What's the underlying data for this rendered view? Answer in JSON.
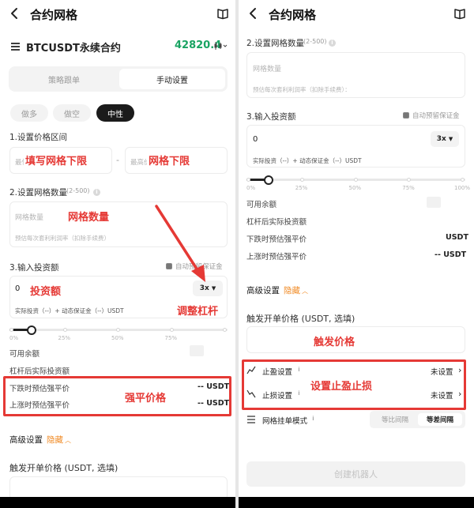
{
  "left": {
    "header": {
      "title": "合约网格"
    },
    "pair": {
      "name": "BTCUSDT永续合约",
      "price": "42820.4"
    },
    "tabs": [
      {
        "label": "策略跟单"
      },
      {
        "label": "手动设置"
      }
    ],
    "modes": [
      {
        "label": "做多"
      },
      {
        "label": "做空"
      },
      {
        "label": "中性"
      }
    ],
    "price_range": {
      "label": "1.设置价格区间",
      "lower_placeholder": "最低价",
      "upper_placeholder": "最高价",
      "dash": "-"
    },
    "grid_count": {
      "label": "2.设置网格数量",
      "range": "(2-500)",
      "placeholder": "网格数量",
      "hint": "预估每次套利利润率（扣除手续费）"
    },
    "invest": {
      "label": "3.输入投资额",
      "auto_margin": "自动预留保证金",
      "value": "0",
      "leverage": "3x",
      "detail": "实际投资（--）+ 动态保证金（--）USDT"
    },
    "slider": {
      "level": 0.1,
      "ticks": [
        "0%",
        "25%",
        "50%",
        "75%"
      ]
    },
    "rows": [
      {
        "label": "可用余额",
        "value": ""
      },
      {
        "label": "杠杆后实际投资额",
        "value": ""
      },
      {
        "label": "下跌时预估强平价",
        "value": "-- USDT"
      },
      {
        "label": "上涨时预估强平价",
        "value": "-- USDT"
      }
    ],
    "advanced": {
      "label": "高级设置",
      "toggle": "隐藏"
    },
    "trigger": {
      "label": "触发开单价格 (USDT, 选填)"
    },
    "annotations": {
      "lower": "填写网格下限",
      "upper": "网格下限",
      "count": "网格数量",
      "invest": "投资额",
      "leverage": "调整杠杆",
      "liq": "强平价格"
    }
  },
  "right": {
    "header": {
      "title": "合约网格"
    },
    "grid_count": {
      "label": "2.设置网格数量",
      "range": "(2-500)",
      "placeholder": "网格数量",
      "hint": "预估每次套利利润率（扣除手续费）："
    },
    "invest": {
      "label": "3.输入投资额",
      "auto_margin": "自动预留保证金",
      "value": "0",
      "leverage": "3x",
      "detail": "实际投资（--）+ 动态保证金（--）USDT"
    },
    "slider": {
      "level": 0.1,
      "ticks": [
        "0%",
        "25%",
        "50%",
        "75%",
        "100%"
      ]
    },
    "rows": [
      {
        "label": "可用余额",
        "value": ""
      },
      {
        "label": "杠杆后实际投资额",
        "value": ""
      },
      {
        "label": "下跌时预估强平价",
        "value": "USDT"
      },
      {
        "label": "上涨时预估强平价",
        "value": "-- USDT"
      }
    ],
    "advanced": {
      "label": "高级设置",
      "toggle": "隐藏"
    },
    "trigger": {
      "label": "触发开单价格 (USDT, 选填)"
    },
    "tp": {
      "label": "止盈设置",
      "value": "未设置"
    },
    "sl": {
      "label": "止损设置",
      "value": "未设置"
    },
    "grid_mode": {
      "label": "网格挂单模式",
      "options": [
        "等比间隔",
        "等差间隔"
      ]
    },
    "create": {
      "label": "创建机器人"
    },
    "annotations": {
      "trigger": "触发价格",
      "tpsl": "设置止盈止损"
    }
  },
  "colors": {
    "accent_green": "#1aa463",
    "annotation_red": "#e53935",
    "orange": "#f08a24"
  },
  "icons": [
    "back-arrow-icon",
    "book-icon",
    "list-icon",
    "chart-icon",
    "chevron-right-icon",
    "caret-down-icon",
    "info-icon",
    "checkbox-icon",
    "red-arrow-icon"
  ]
}
